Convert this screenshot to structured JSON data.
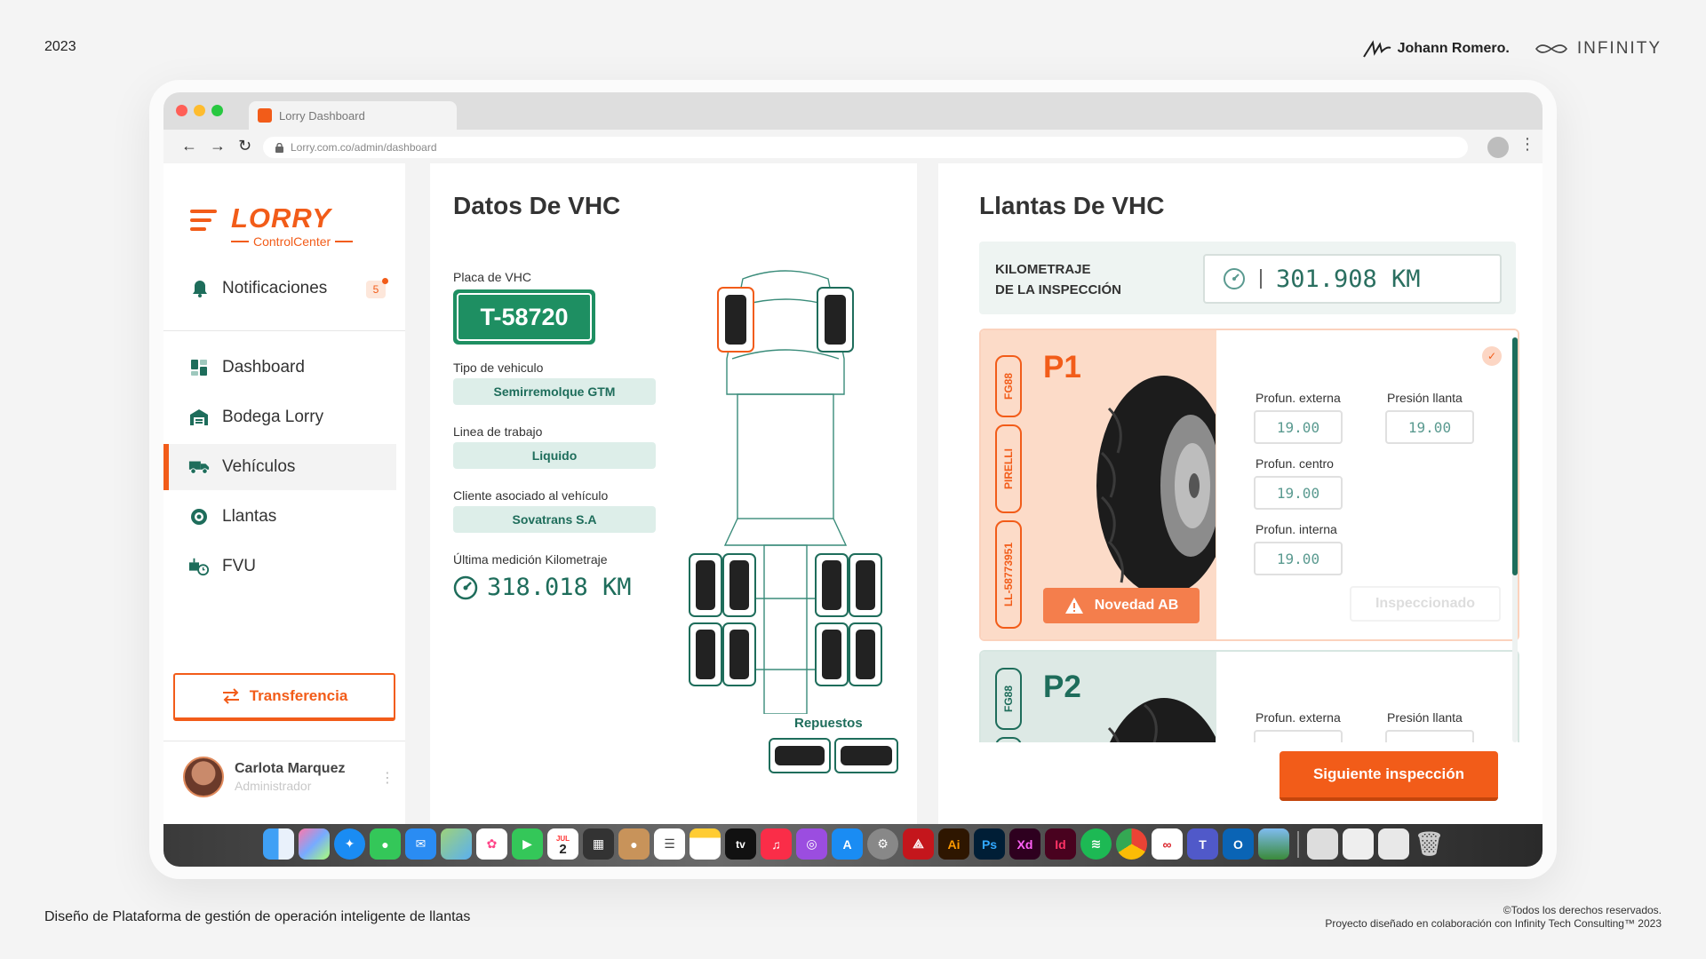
{
  "page": {
    "year": "2023",
    "credit_name": "Johann Romero.",
    "credit_brand": "INFINITY",
    "footer_left": "Diseño de Plataforma de gestión de operación inteligente de llantas",
    "footer_right_1": "©Todos los derechos reservados.",
    "footer_right_2": "Proyecto diseñado en colaboración con Infinity Tech Consulting™ 2023"
  },
  "browser": {
    "tab_title": "Lorry Dashboard",
    "url": "Lorry.com.co/admin/dashboard"
  },
  "sidebar": {
    "logo": "LORRY",
    "logo_sub": "ControlCenter",
    "notifications_label": "Notificaciones",
    "notifications_count": "5",
    "items": [
      {
        "label": "Dashboard",
        "icon": "dashboard-icon"
      },
      {
        "label": "Bodega Lorry",
        "icon": "warehouse-icon"
      },
      {
        "label": "Vehículos",
        "icon": "truck-icon",
        "active": true
      },
      {
        "label": "Llantas",
        "icon": "tire-icon"
      },
      {
        "label": "FVU",
        "icon": "fvu-icon"
      }
    ],
    "transfer_label": "Transferencia",
    "user_name": "Carlota Marquez",
    "user_role": "Administrador"
  },
  "vehicle": {
    "title": "Datos De VHC",
    "plate_label": "Placa de VHC",
    "plate": "T-58720",
    "type_label": "Tipo de vehiculo",
    "type": "Semirremolque GTM",
    "line_label": "Linea de trabajo",
    "line": "Liquido",
    "client_label": "Cliente asociado al vehículo",
    "client": "Sovatrans S.A",
    "km_label": "Última medición Kilometraje",
    "km": "318.018 KM",
    "spares_label": "Repuestos"
  },
  "tires": {
    "title": "Llantas De VHC",
    "km_label_1": "KILOMETRAJE",
    "km_label_2": "DE LA INSPECCIÓN",
    "km_value": "301.908 KM",
    "cards": [
      {
        "name": "P1",
        "tag_1": "FG88",
        "tag_2": "PIRELLI",
        "tag_3": "LL-58773951",
        "novedad": "Novedad AB",
        "ext_label": "Profun. externa",
        "ext_value": "19.00",
        "press_label": "Presión llanta",
        "press_value": "19.00",
        "center_label": "Profun. centro",
        "center_value": "19.00",
        "int_label": "Profun. interna",
        "int_value": "19.00",
        "inspected_label": "Inspeccionado"
      },
      {
        "name": "P2",
        "tag_1": "FG88",
        "ext_label": "Profun. externa",
        "press_label": "Presión llanta"
      }
    ],
    "next_label": "Siguiente inspección"
  },
  "dock": {
    "calendar_month": "JUL",
    "calendar_day": "2",
    "apps": [
      "finder",
      "launchpad",
      "safari",
      "messages",
      "mail",
      "maps",
      "photos",
      "facetime",
      "calendar",
      "calculator",
      "contacts",
      "reminders",
      "notes",
      "tv",
      "music",
      "podcasts",
      "app-store",
      "system-settings",
      "acrobat",
      "illustrator",
      "photoshop",
      "xd",
      "indesign",
      "spotify",
      "chrome",
      "creative-cloud",
      "teams",
      "outlook",
      "preview"
    ],
    "labels": {
      "tv": "tv",
      "illustrator": "Ai",
      "photoshop": "Ps",
      "xd": "Xd",
      "indesign": "Id"
    }
  },
  "colors": {
    "accent": "#f25c19",
    "primary": "#1e6d5b",
    "plate": "#1e8f62",
    "p1_bg": "#fcdbc8",
    "p2_bg": "#dde9e5"
  }
}
